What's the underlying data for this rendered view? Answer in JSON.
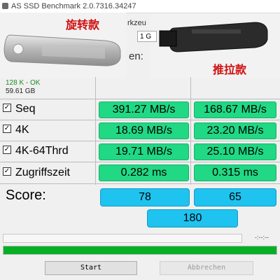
{
  "window": {
    "title": "AS SSD Benchmark 2.0.7316.34247"
  },
  "overlay": {
    "left_label": "旋转款",
    "right_label": "推拉款"
  },
  "partial": {
    "tools_menu": "rkzeu",
    "drive": "1 G",
    "col_header": "en:"
  },
  "info": {
    "status": "128 K - OK",
    "size": "59.61 GB"
  },
  "rows": [
    {
      "label": "Seq",
      "read": "391.27 MB/s",
      "write": "168.67 MB/s",
      "checked": true
    },
    {
      "label": "4K",
      "read": "18.69 MB/s",
      "write": "23.20 MB/s",
      "checked": true
    },
    {
      "label": "4K-64Thrd",
      "read": "19.71 MB/s",
      "write": "25.10 MB/s",
      "checked": true
    },
    {
      "label": "Zugriffszeit",
      "read": "0.282 ms",
      "write": "0.315 ms",
      "checked": true
    }
  ],
  "score": {
    "label": "Score:",
    "read": "78",
    "write": "65",
    "total": "180"
  },
  "timer": "-:--:--",
  "progress": {
    "value": 1.0
  },
  "buttons": {
    "start": "Start",
    "abort": "Abbrechen"
  },
  "colors": {
    "result_green": "#21d884",
    "score_blue": "#1ec3ef",
    "progress_green": "#06b025",
    "label_red": "#d01010"
  }
}
